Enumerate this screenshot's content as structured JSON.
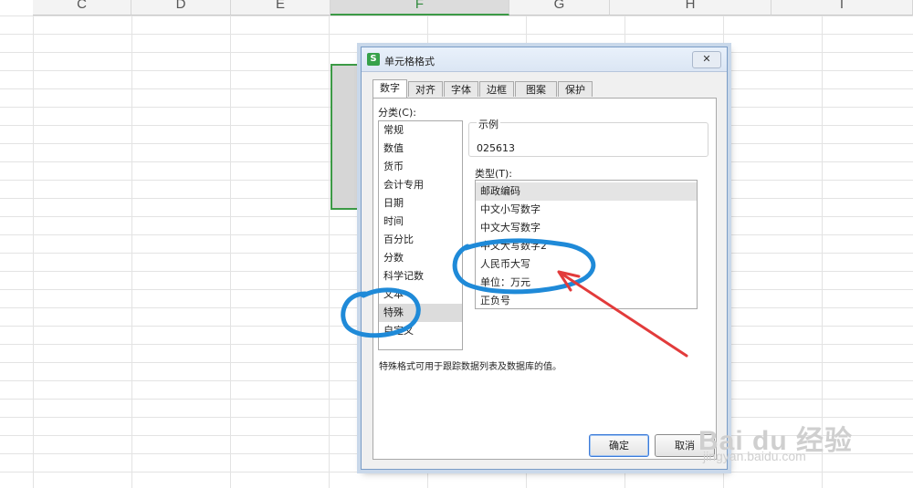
{
  "sheet": {
    "columns": [
      "C",
      "D",
      "E",
      "F",
      "G",
      "H",
      "I"
    ],
    "active_column": "F"
  },
  "dialog": {
    "title": "单元格格式",
    "close": "✕",
    "tabs": [
      "数字",
      "对齐",
      "字体",
      "边框",
      "图案",
      "保护"
    ],
    "active_tab": "数字",
    "category_label": "分类(C):",
    "categories": [
      "常规",
      "数值",
      "货币",
      "会计专用",
      "日期",
      "时间",
      "百分比",
      "分数",
      "科学记数",
      "文本",
      "特殊",
      "自定义"
    ],
    "selected_category": "特殊",
    "sample_label": "示例",
    "sample_value": "025613",
    "type_label": "类型(T):",
    "types": [
      "邮政编码",
      "中文小写数字",
      "中文大写数字",
      "中文大写数字2",
      "人民币大写",
      "单位：万元",
      "正负号"
    ],
    "selected_type": "邮政编码",
    "description": "特殊格式可用于跟踪数据列表及数据库的值。",
    "ok": "确定",
    "cancel": "取消"
  },
  "watermark": {
    "main": "Bai du 经验",
    "sub": "jingyan.baidu.com"
  },
  "colors": {
    "accent_green": "#3c9a46",
    "annotation_blue": "#1f8ad8",
    "annotation_red": "#e23b3b"
  }
}
